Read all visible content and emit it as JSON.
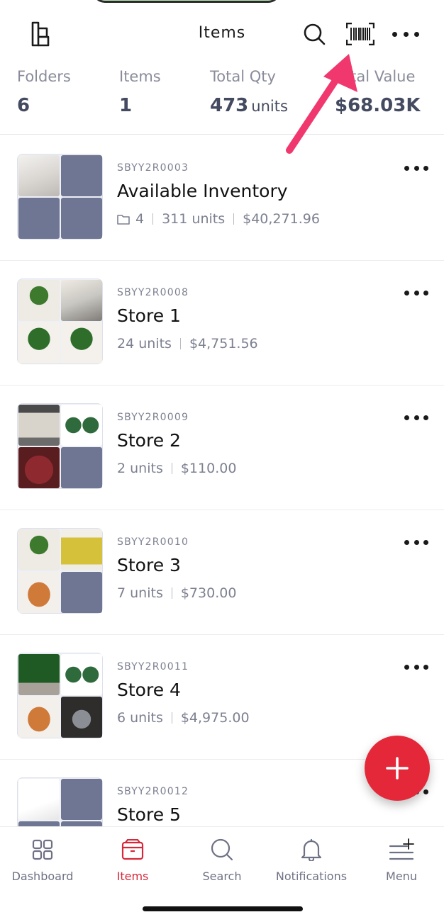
{
  "header": {
    "title": "Items",
    "icons": [
      "logo-icon",
      "search-icon",
      "barcode-icon",
      "more-icon"
    ]
  },
  "stats": {
    "folders": {
      "label": "Folders",
      "value": "6"
    },
    "items": {
      "label": "Items",
      "value": "1"
    },
    "total_qty": {
      "label": "Total Qty",
      "value": "473",
      "unit": "units"
    },
    "total_value": {
      "label": "Total Value",
      "value": "$68.03K"
    }
  },
  "rows": [
    {
      "sku": "SBYY2R0003",
      "name": "Available Inventory",
      "folders": "4",
      "units": "311 units",
      "value": "$40,271.96"
    },
    {
      "sku": "SBYY2R0008",
      "name": "Store 1",
      "units": "24 units",
      "value": "$4,751.56"
    },
    {
      "sku": "SBYY2R0009",
      "name": "Store 2",
      "units": "2 units",
      "value": "$110.00"
    },
    {
      "sku": "SBYY2R0010",
      "name": "Store 3",
      "units": "7 units",
      "value": "$730.00"
    },
    {
      "sku": "SBYY2R0011",
      "name": "Store 4",
      "units": "6 units",
      "value": "$4,975.00"
    },
    {
      "sku": "SBYY2R0012",
      "name": "Store 5"
    }
  ],
  "tabs": [
    {
      "label": "Dashboard",
      "icon": "grid-icon",
      "active": false
    },
    {
      "label": "Items",
      "icon": "box-icon",
      "active": true
    },
    {
      "label": "Search",
      "icon": "search-icon",
      "active": false
    },
    {
      "label": "Notifications",
      "icon": "bell-icon",
      "active": false
    },
    {
      "label": "Menu",
      "icon": "menu-icon",
      "active": false
    }
  ],
  "colors": {
    "accent": "#e42839",
    "active_tab": "#d6283a",
    "placeholder_tile": "#6f7693",
    "annotation_arrow": "#f0386e"
  }
}
